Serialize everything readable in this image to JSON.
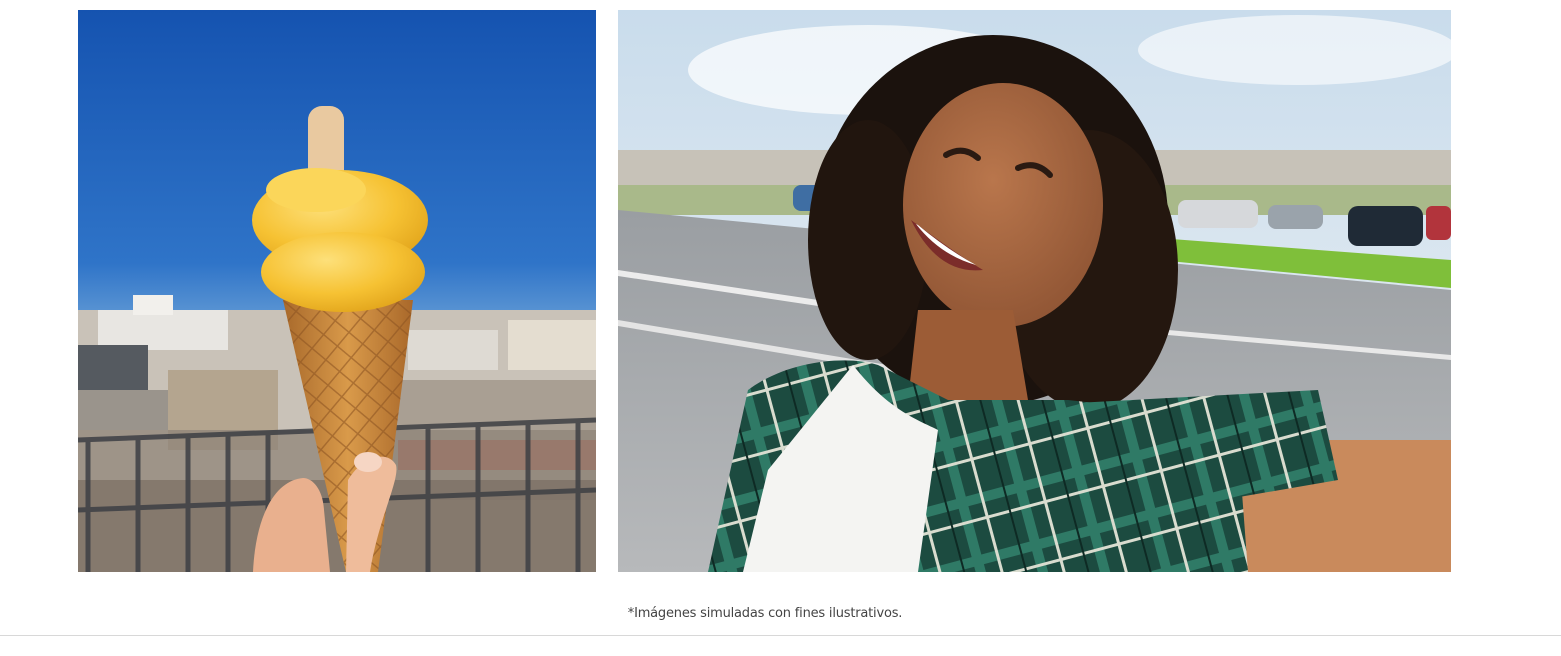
{
  "gallery": {
    "images": [
      {
        "name": "ice-cream-cone-photo",
        "subject": "hand holding a mango ice cream cone against a blue sky"
      },
      {
        "name": "woman-selfie-photo",
        "subject": "smiling woman with curly hair taking a selfie by a road"
      }
    ]
  },
  "footnote": {
    "text": "*Imágenes simuladas con fines ilustrativos."
  },
  "colors": {
    "sky_blue": "#1e5fb4",
    "ice_cream_yellow": "#f6c233",
    "cone_brown": "#c98a3d",
    "plaid_green": "#1f5a4a",
    "divider": "#d8d8d8",
    "footnote_text": "#444444"
  }
}
